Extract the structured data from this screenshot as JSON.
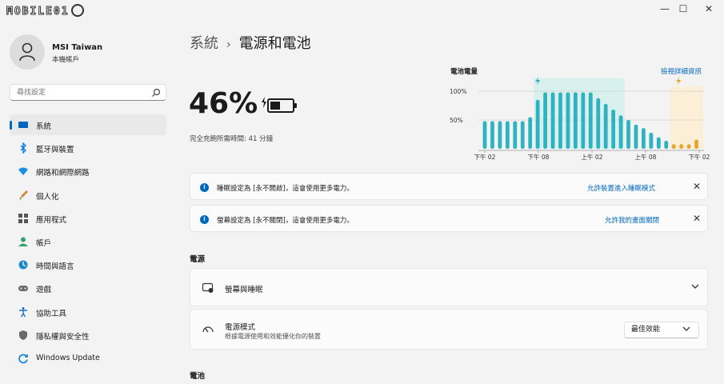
{
  "window": {
    "logo_text": "MOBILE01",
    "buttons": {
      "minimize": "—",
      "maximize": "☐",
      "close": "✕"
    }
  },
  "sidebar": {
    "user_name": "MSI Taiwan",
    "user_sub": "本機帳戶",
    "search_placeholder": "尋找設定",
    "items": [
      {
        "label": "系統",
        "icon": "monitor-icon",
        "color": "#0067c0"
      },
      {
        "label": "藍牙與裝置",
        "icon": "bluetooth-icon",
        "color": "#0a7cd8"
      },
      {
        "label": "網路和網際網路",
        "icon": "wifi-icon",
        "color": "#1a8fe0"
      },
      {
        "label": "個人化",
        "icon": "brush-icon",
        "color": "#d08a3a"
      },
      {
        "label": "應用程式",
        "icon": "apps-icon",
        "color": "#555555"
      },
      {
        "label": "帳戶",
        "icon": "person-icon",
        "color": "#2fa26b"
      },
      {
        "label": "時間與語言",
        "icon": "globe-clock-icon",
        "color": "#1f86c9"
      },
      {
        "label": "遊戲",
        "icon": "gamepad-icon",
        "color": "#6b6b6b"
      },
      {
        "label": "協助工具",
        "icon": "accessibility-icon",
        "color": "#1a6fc0"
      },
      {
        "label": "隱私權與安全性",
        "icon": "shield-icon",
        "color": "#6a6a6a"
      },
      {
        "label": "Windows Update",
        "icon": "update-icon",
        "color": "#0a7cd8"
      }
    ]
  },
  "main": {
    "breadcrumb_root": "系統",
    "breadcrumb_sep": "›",
    "breadcrumb_current": "電源和電池",
    "battery_percent": "46%",
    "battery_level": 0.46,
    "charge_time": "完全充飽所需時間: 41 分鐘",
    "chart_title": "電池電量",
    "chart_link": "檢視詳細資訊",
    "notices": [
      {
        "text": "睡眠設定為 [永不開啟]，這會使用更多電力。",
        "link": "允許裝置進入睡眠模式",
        "close": "✕"
      },
      {
        "text": "螢幕設定為 [永不關閉]，這會使用更多電力。",
        "link": "允許我的畫面關閉",
        "close": "✕"
      }
    ],
    "section_power": "電源",
    "card_screen_sleep": "螢幕與睡眠",
    "card_power_mode": {
      "title": "電源模式",
      "subtitle": "根據電源使用和效能優化你的裝置",
      "value": "最佳效能"
    },
    "section_battery": "電池"
  },
  "chart_data": {
    "type": "bar",
    "ylabels": [
      "100%",
      "50%"
    ],
    "xlabels": [
      "下午 02",
      "下午 08",
      "上午 02",
      "上午 08",
      "下午 02"
    ],
    "ylim": [
      0,
      100
    ],
    "values": [
      48,
      48,
      48,
      48,
      48,
      48,
      55,
      85,
      98,
      98,
      98,
      98,
      98,
      98,
      98,
      88,
      78,
      68,
      58,
      50,
      42,
      36,
      28,
      20,
      14
    ],
    "estimated": [
      8,
      8,
      8,
      16
    ],
    "bar_color": "#2fb3c0",
    "estimated_color": "#e9a530",
    "highlight_color": "#d8f1ee",
    "estimated_bg": "#fcefd8"
  }
}
